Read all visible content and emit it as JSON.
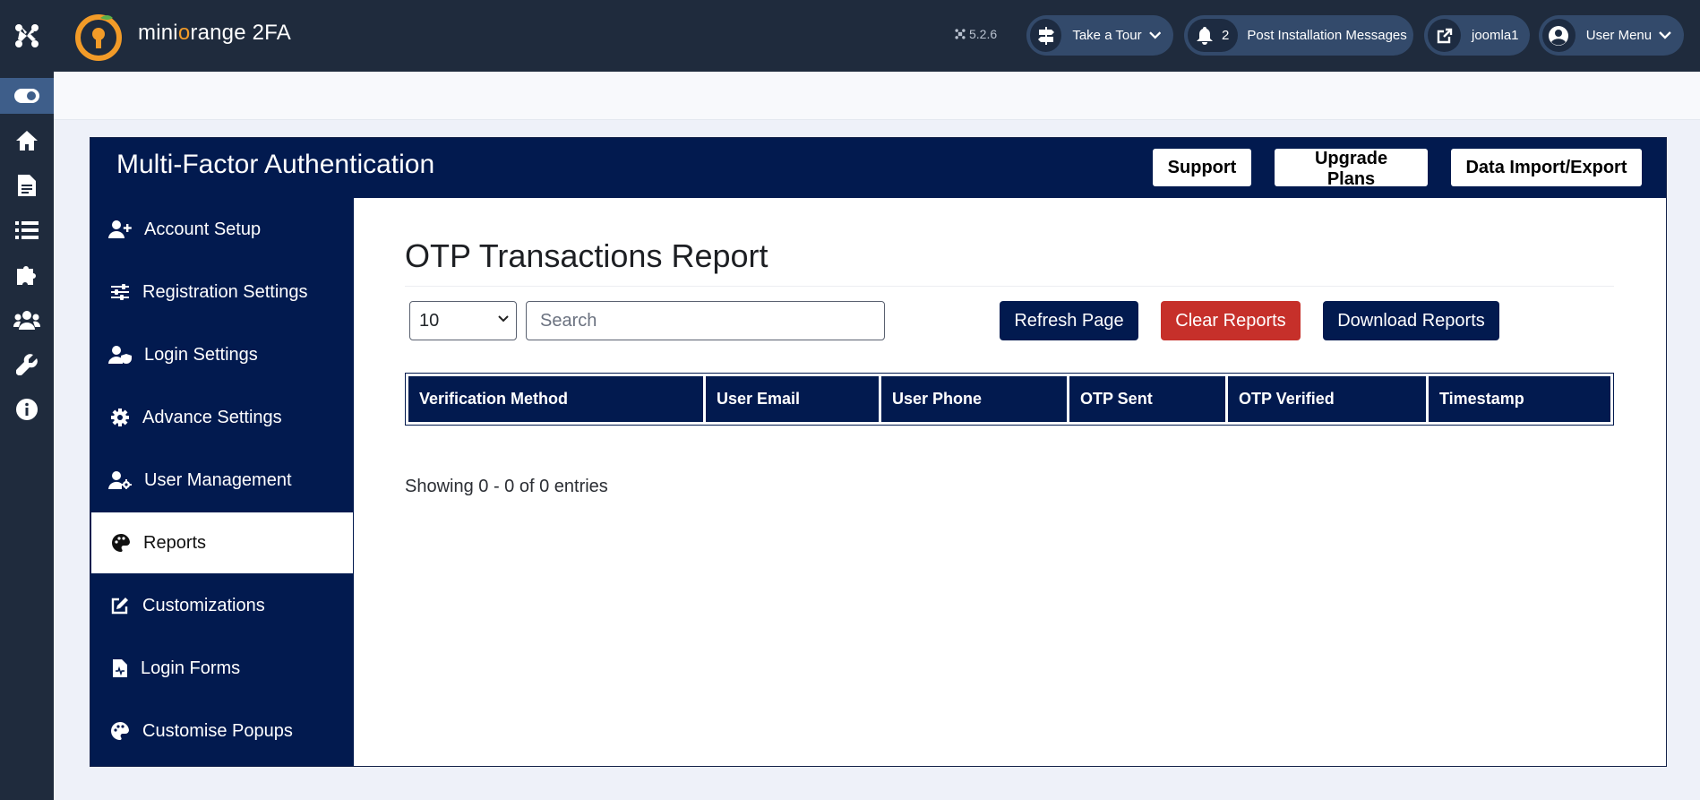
{
  "app": {
    "brand_prefix": "mini",
    "brand_o": "o",
    "brand_suffix": "range 2FA",
    "version": "5.2.6"
  },
  "rail": {
    "items": [
      "joomla-logo-icon",
      "toggle-icon",
      "home-icon",
      "document-icon",
      "list-icon",
      "puzzle-icon",
      "users-icon",
      "wrench-icon",
      "info-icon"
    ]
  },
  "header": {
    "take_tour": "Take a Tour",
    "notifications_count": "2",
    "post_install": "Post Installation Messages",
    "site_link": "joomla1",
    "user_menu": "User Menu"
  },
  "panel": {
    "title": "Multi-Factor Authentication",
    "buttons": [
      "Support",
      "Upgrade Plans",
      "Data Import/Export"
    ]
  },
  "sidebar": {
    "items": [
      {
        "label": "Account Setup",
        "icon": "user-plus-icon"
      },
      {
        "label": "Registration Settings",
        "icon": "sliders-icon"
      },
      {
        "label": "Login Settings",
        "icon": "user-shield-icon"
      },
      {
        "label": "Advance Settings",
        "icon": "gear-icon"
      },
      {
        "label": "User Management",
        "icon": "user-gear-icon"
      },
      {
        "label": "Reports",
        "icon": "palette-icon",
        "active": true
      },
      {
        "label": "Customizations",
        "icon": "edit-icon"
      },
      {
        "label": "Login Forms",
        "icon": "file-icon"
      },
      {
        "label": "Customise Popups",
        "icon": "palette-icon"
      }
    ]
  },
  "report": {
    "title": "OTP Transactions Report",
    "page_size": "10",
    "search_placeholder": "Search",
    "refresh_label": "Refresh Page",
    "clear_label": "Clear Reports",
    "download_label": "Download Reports",
    "columns": [
      "Verification Method",
      "User Email",
      "User Phone",
      "OTP Sent",
      "OTP Verified",
      "Timestamp"
    ],
    "showing": "Showing 0 - 0 of 0 entries"
  },
  "colors": {
    "navy": "#021a4f",
    "topbar": "#1f2b3d",
    "danger": "#c6302a",
    "accent_orange": "#f29b28"
  }
}
